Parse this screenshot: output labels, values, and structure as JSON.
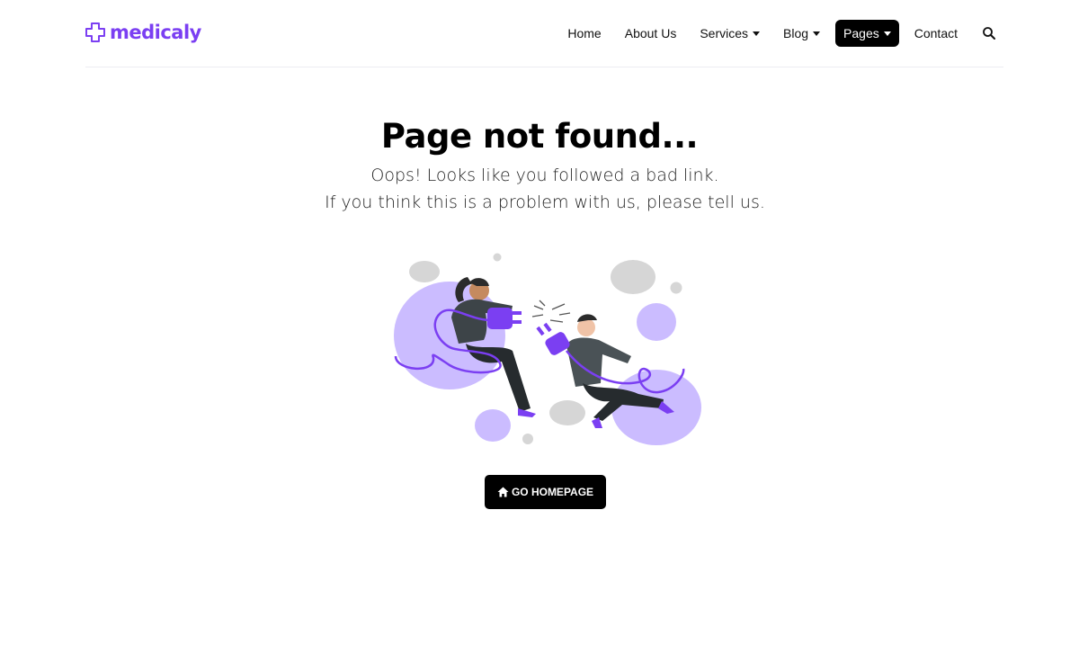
{
  "brand": {
    "name": "medicaly",
    "accent_color": "#7b3ff2"
  },
  "nav": {
    "items": [
      {
        "label": "Home",
        "dropdown": false,
        "active": false
      },
      {
        "label": "About Us",
        "dropdown": false,
        "active": false
      },
      {
        "label": "Services",
        "dropdown": true,
        "active": false
      },
      {
        "label": "Blog",
        "dropdown": true,
        "active": false
      },
      {
        "label": "Pages",
        "dropdown": true,
        "active": true
      },
      {
        "label": "Contact",
        "dropdown": false,
        "active": false
      }
    ],
    "search_icon": "search-icon"
  },
  "error": {
    "title": "Page not found...",
    "line1": "Oops! Looks like you followed a bad link.",
    "line2": "If you think this is a problem with us, please tell us."
  },
  "illustration": {
    "name": "two-people-disconnected-plug"
  },
  "cta": {
    "label": "GO HOMEPAGE",
    "icon": "home-icon"
  }
}
